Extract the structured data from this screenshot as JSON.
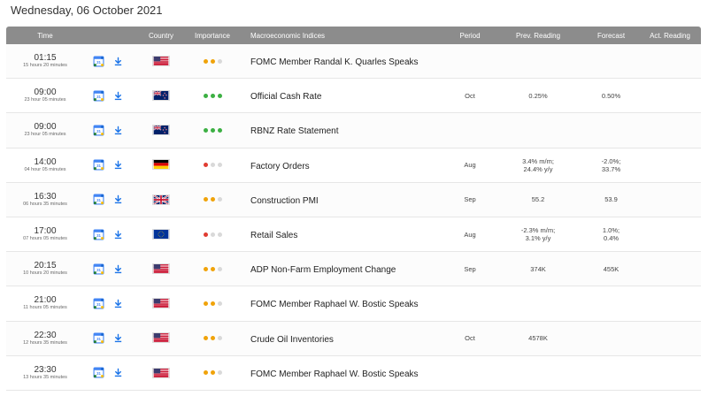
{
  "title": "Wednesday, 06 October 2021",
  "headers": {
    "time": "Time",
    "country": "Country",
    "importance": "Importance",
    "indices": "Macroeconomic Indices",
    "period": "Period",
    "prev": "Prev. Reading",
    "forecast": "Forecast",
    "actual": "Act. Reading"
  },
  "rows": [
    {
      "time": "01:15",
      "until": "15 hours 20 minutes",
      "flag": "us",
      "importance": "medium",
      "name": "FOMC Member Randal K. Quarles Speaks",
      "period": "",
      "prev1": "",
      "prev2": "",
      "fore1": "",
      "fore2": "",
      "actual": ""
    },
    {
      "time": "09:00",
      "until": "23 hour 05 minutes",
      "flag": "nz",
      "importance": "high",
      "name": "Official Cash Rate",
      "period": "Oct",
      "prev1": "0.25%",
      "prev2": "",
      "fore1": "0.50%",
      "fore2": "",
      "actual": ""
    },
    {
      "time": "09:00",
      "until": "23 hour 05 minutes",
      "flag": "nz",
      "importance": "high",
      "name": "RBNZ Rate Statement",
      "period": "",
      "prev1": "",
      "prev2": "",
      "fore1": "",
      "fore2": "",
      "actual": ""
    },
    {
      "time": "14:00",
      "until": "04 hour 05 minutes",
      "flag": "de",
      "importance": "low",
      "name": "Factory Orders",
      "period": "Aug",
      "prev1": "3.4% m/m;",
      "prev2": "24.4% y/y",
      "fore1": "-2.0%;",
      "fore2": "33.7%",
      "actual": ""
    },
    {
      "time": "16:30",
      "until": "06 hours 35 minutes",
      "flag": "uk",
      "importance": "medium",
      "name": "Construction PMI",
      "period": "Sep",
      "prev1": "55.2",
      "prev2": "",
      "fore1": "53.9",
      "fore2": "",
      "actual": ""
    },
    {
      "time": "17:00",
      "until": "07 hours 05 minutes",
      "flag": "eu",
      "importance": "low",
      "name": "Retail Sales",
      "period": "Aug",
      "prev1": "-2.3% m/m;",
      "prev2": "3.1% y/y",
      "fore1": "1.0%;",
      "fore2": "0.4%",
      "actual": ""
    },
    {
      "time": "20:15",
      "until": "10 hours 20 minutes",
      "flag": "us",
      "importance": "medium",
      "name": "ADP Non-Farm Employment Change",
      "period": "Sep",
      "prev1": "374K",
      "prev2": "",
      "fore1": "455K",
      "fore2": "",
      "actual": ""
    },
    {
      "time": "21:00",
      "until": "11 hours 05 minutes",
      "flag": "us",
      "importance": "medium",
      "name": "FOMC Member Raphael W. Bostic Speaks",
      "period": "",
      "prev1": "",
      "prev2": "",
      "fore1": "",
      "fore2": "",
      "actual": ""
    },
    {
      "time": "22:30",
      "until": "12 hours 35 minutes",
      "flag": "us",
      "importance": "medium",
      "name": "Crude Oil Inventories",
      "period": "Oct",
      "prev1": "4578K",
      "prev2": "",
      "fore1": "",
      "fore2": "",
      "actual": ""
    },
    {
      "time": "23:30",
      "until": "13 hours 35 minutes",
      "flag": "us",
      "importance": "medium",
      "name": "FOMC Member Raphael W. Bostic Speaks",
      "period": "",
      "prev1": "",
      "prev2": "",
      "fore1": "",
      "fore2": "",
      "actual": ""
    }
  ],
  "icons": {
    "calendar": "google-calendar-icon",
    "download": "download-icon"
  },
  "colors": {
    "header_bg": "#8c8c8c",
    "high": "#3cb043",
    "medium": "#f0a30a",
    "low": "#e03c31",
    "inactive": "#d9d9d9",
    "download": "#1a73e8"
  }
}
